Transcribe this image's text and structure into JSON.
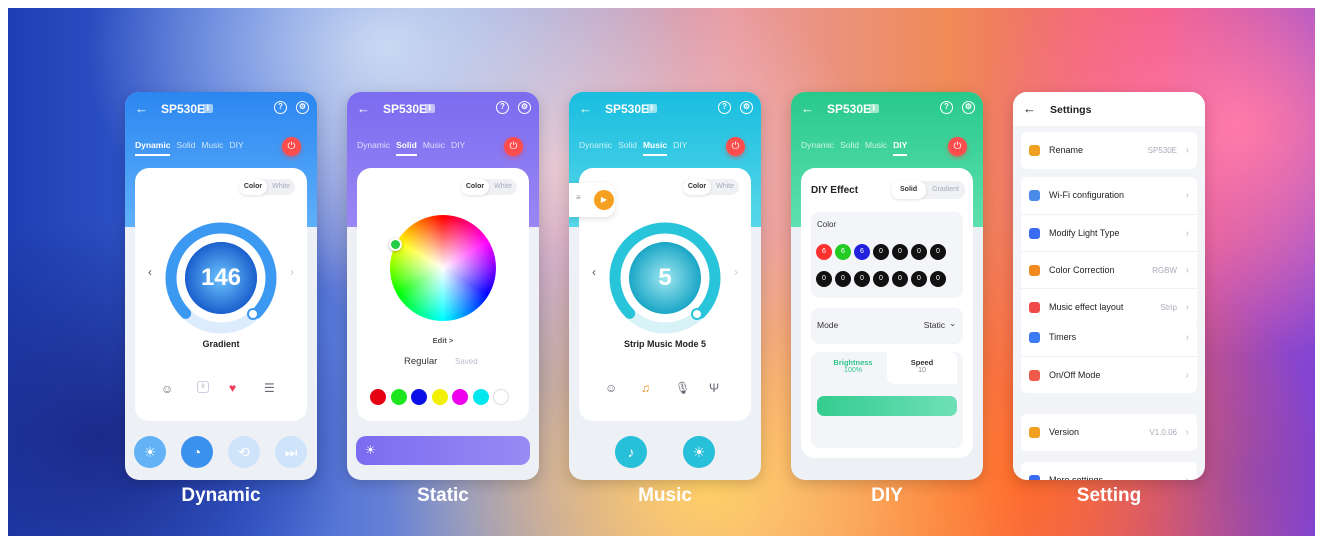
{
  "device": "SP530E",
  "tabs": [
    "Dynamic",
    "Solid",
    "Music",
    "DIY"
  ],
  "colors": {
    "dynamic": "#2f8ff0",
    "static": "#8a6cf0",
    "music": "#28c4d9",
    "diy": "#34cf91",
    "power": "#ff4d4d"
  },
  "segment": {
    "color": "Color",
    "white": "White"
  },
  "dynamic": {
    "value": "146",
    "mode": "Gradient",
    "caption": "Dynamic",
    "icons": [
      "emoji-icon",
      "pause-icon",
      "heart-icon",
      "list-icon"
    ],
    "bottom": [
      "sun-icon",
      "speed-icon",
      "loop-icon",
      "skip-icon"
    ]
  },
  "static": {
    "edit": "Edit >",
    "regular": "Regular",
    "saved": "Saved",
    "swatches": [
      "#e60012",
      "#1ee61e",
      "#0a10e6",
      "#f0f000",
      "#ee00ee",
      "#00e8ee",
      "#ffffff"
    ],
    "caption": "Static"
  },
  "music": {
    "value": "5",
    "mode": "Strip Music Mode 5",
    "caption": "Music",
    "icons": [
      "emoji-icon",
      "music-note-icon",
      "microphone-icon",
      "mic-stand-icon"
    ]
  },
  "diy": {
    "title": "DIY Effect",
    "seg": [
      "Solid",
      "Gradient"
    ],
    "color_label": "Color",
    "row1": [
      "6",
      "6",
      "6",
      "0",
      "0",
      "0",
      "0"
    ],
    "row2": [
      "0",
      "0",
      "0",
      "0",
      "0",
      "0",
      "0"
    ],
    "row1_colors": [
      "#ff3030",
      "#22cc22",
      "#2222dd",
      "#111111",
      "#111111",
      "#111111",
      "#111111"
    ],
    "mode_label": "Mode",
    "mode_value": "Static",
    "brightness_label": "Brightness",
    "brightness_value": "100%",
    "speed_label": "Speed",
    "speed_value": "10",
    "caption": "DIY"
  },
  "settings": {
    "title": "Settings",
    "caption": "Setting",
    "items": [
      {
        "label": "Rename",
        "value": "SP530E",
        "icon": "pencil-icon",
        "color": "#f0a020"
      },
      {
        "label": "Wi-Fi configuration",
        "value": "",
        "icon": "wifi-icon",
        "color": "#4a8ae8"
      },
      {
        "label": "Modify Light Type",
        "value": "",
        "icon": "bulb-icon",
        "color": "#3b6cf0"
      },
      {
        "label": "Color Correction",
        "value": "RGBW",
        "icon": "palette-icon",
        "color": "#f08a20"
      },
      {
        "label": "Music effect layout",
        "value": "Strip",
        "icon": "music-icon",
        "color": "#f04a4a"
      },
      {
        "label": "Timers",
        "value": "",
        "icon": "clock-icon",
        "color": "#3b7af0"
      },
      {
        "label": "On/Off Mode",
        "value": "",
        "icon": "power-mode-icon",
        "color": "#f05a4a"
      },
      {
        "label": "Version",
        "value": "V1.0.06",
        "icon": "version-icon",
        "color": "#f0a020"
      },
      {
        "label": "More settings",
        "value": "",
        "icon": "more-icon",
        "color": "#3b6cf0"
      }
    ]
  }
}
